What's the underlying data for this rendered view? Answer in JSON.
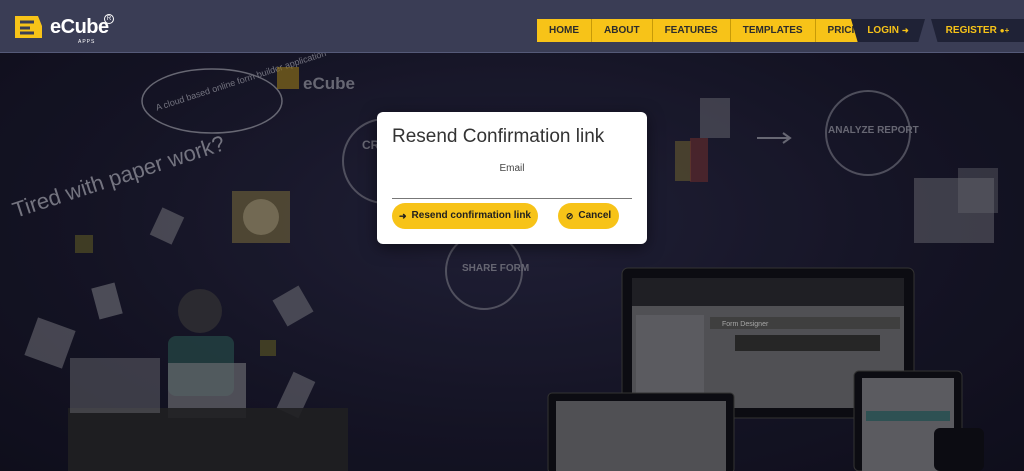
{
  "header": {
    "brand": "eCube",
    "brand_sub": "APPS",
    "nav": [
      "HOME",
      "ABOUT",
      "FEATURES",
      "TEMPLATES",
      "PRICING"
    ],
    "login_label": "LOGIN",
    "register_label": "REGISTER",
    "accent_color": "#f7c318",
    "bar_color": "#3a3d55"
  },
  "hero": {
    "tagline": "A cloud based online form builder application",
    "tired_text": "Tired with paper work?",
    "create_form": "CREATE FORM",
    "share_form": "SHARE FORM",
    "analyze_report": "ANALYZE REPORT",
    "form_designer": "Form Designer",
    "brand_small": "eCube",
    "brand_small_sub": "APPS"
  },
  "modal": {
    "title": "Resend Confirmation link",
    "email_label": "Email",
    "email_value": "",
    "email_placeholder": "",
    "resend_label": "Resend confirmation link",
    "cancel_label": "Cancel"
  }
}
